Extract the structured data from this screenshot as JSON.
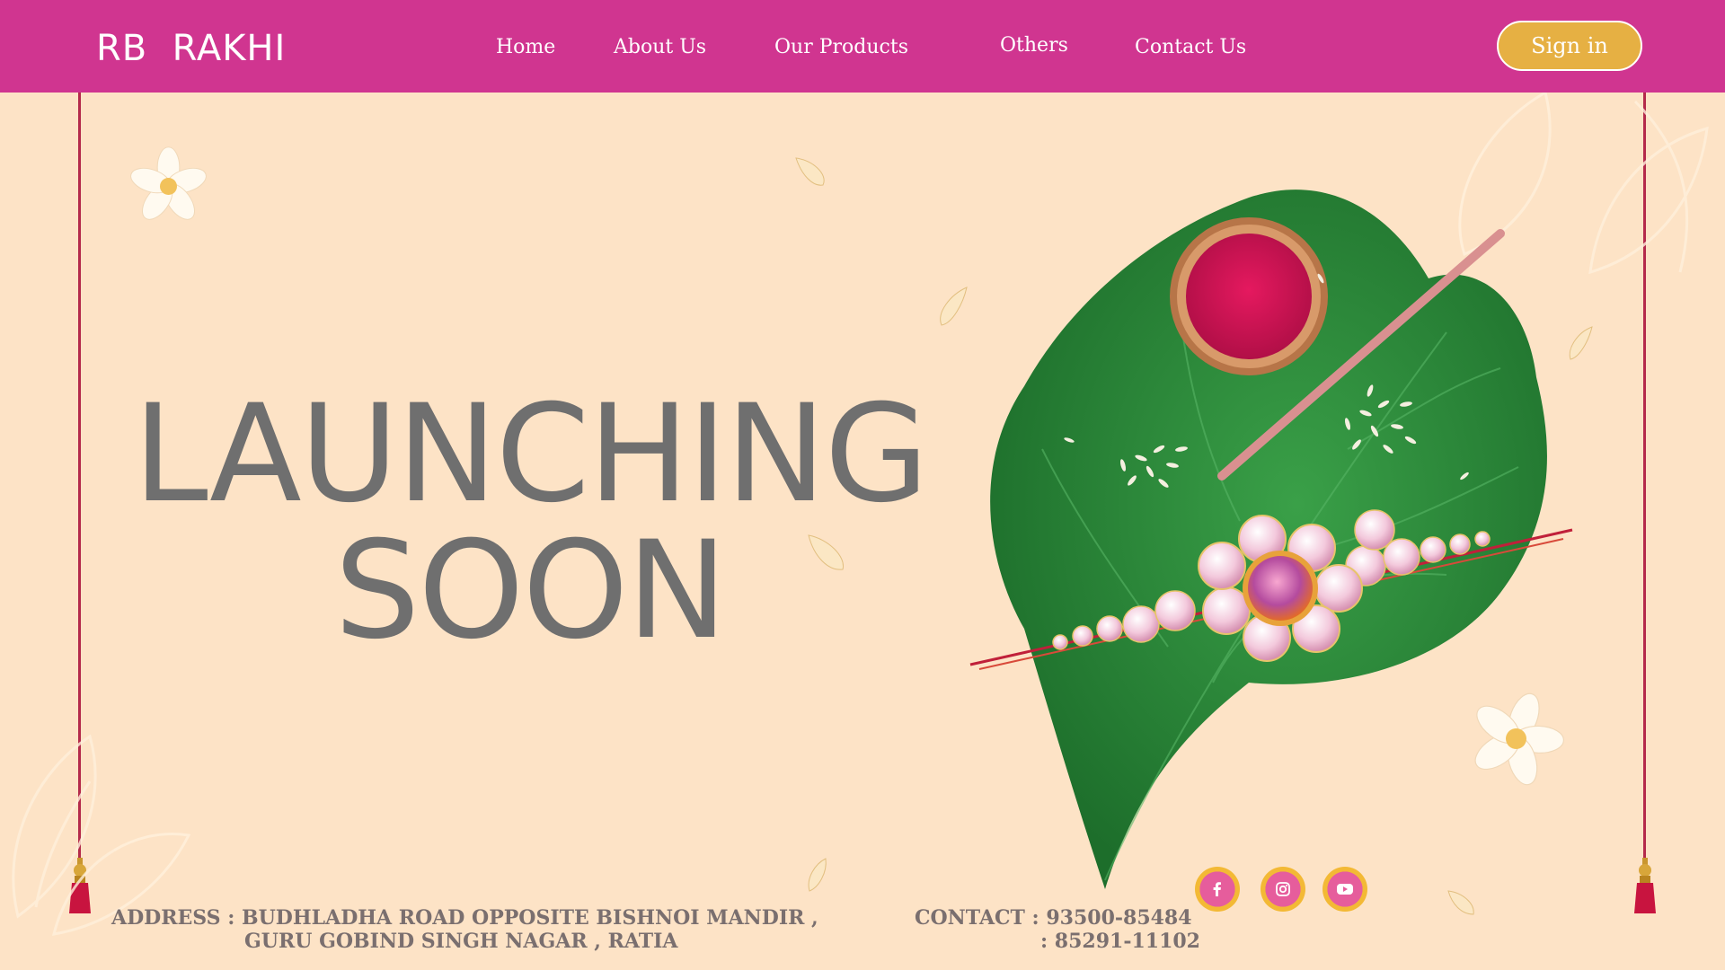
{
  "header": {
    "brand": "RB  RAKHI",
    "nav": [
      {
        "label": "Home"
      },
      {
        "label": "About Us"
      },
      {
        "label": "Our Products"
      },
      {
        "label": "Others"
      },
      {
        "label": "Contact Us"
      }
    ],
    "signin_label": "Sign in"
  },
  "hero": {
    "line1": "LAUNCHING",
    "line2": "SOON"
  },
  "footer": {
    "address_line1": "ADDRESS : BUDHLADHA ROAD OPPOSITE BISHNOI MANDIR ,",
    "address_line2": "GURU GOBIND SINGH NAGAR , RATIA",
    "contact_line1": "CONTACT : 93500-85484",
    "contact_line2": ": 85291-11102"
  },
  "social": [
    {
      "icon": "facebook-icon"
    },
    {
      "icon": "instagram-icon"
    },
    {
      "icon": "youtube-icon"
    }
  ],
  "colors": {
    "header_bg": "#d03590",
    "page_bg": "#fde3c6",
    "signin_bg": "#e6b043",
    "headline": "#6f6f6f",
    "leaf": "#2e8b3c"
  }
}
